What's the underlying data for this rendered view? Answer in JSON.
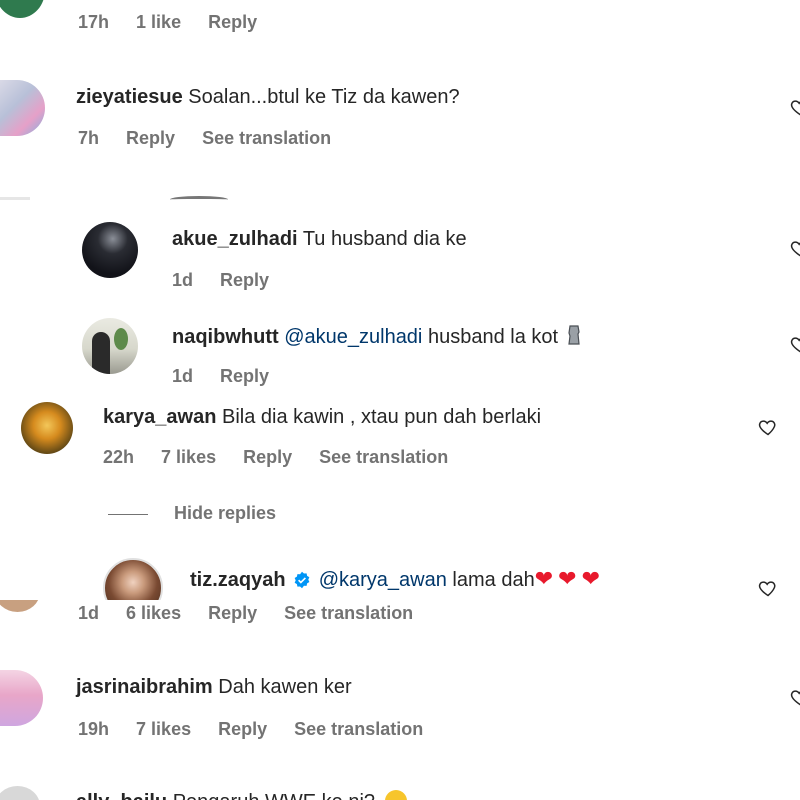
{
  "top": {
    "time": "17h",
    "likes": "1 like",
    "reply": "Reply"
  },
  "c1": {
    "username": "zieyatiesue",
    "text": "Soalan...btul ke Tiz da kawen?",
    "time": "7h",
    "reply": "Reply",
    "translate": "See translation"
  },
  "r1": {
    "username": "akue_zulhadi",
    "text": "Tu husband dia ke",
    "time": "1d",
    "reply": "Reply"
  },
  "r2": {
    "username": "naqibwhutt",
    "mention": "@akue_zulhadi",
    "text": "husband la kot",
    "time": "1d",
    "reply": "Reply"
  },
  "c2": {
    "username": "karya_awan",
    "text": "Bila dia kawin , xtau pun dah berlaki",
    "time": "22h",
    "likes": "7 likes",
    "reply": "Reply",
    "translate": "See translation"
  },
  "hide_replies": "Hide replies",
  "r3": {
    "username": "tiz.zaqyah",
    "mention": "@karya_awan",
    "text": "lama dah",
    "emoji": "❤❤❤"
  },
  "c3meta": {
    "time": "1d",
    "likes": "6 likes",
    "reply": "Reply",
    "translate": "See translation"
  },
  "c4": {
    "username": "jasrinaibrahim",
    "text": "Dah kawen ker",
    "time": "19h",
    "likes": "7 likes",
    "reply": "Reply",
    "translate": "See translation"
  },
  "c5": {
    "username": "ally_bailu",
    "text": "Pengaruh WWE ke ni?"
  },
  "colors": {
    "text": "#262626",
    "meta": "#737373",
    "mention": "#00376b",
    "verified": "#0095f6",
    "heart_red": "#e8192c"
  }
}
